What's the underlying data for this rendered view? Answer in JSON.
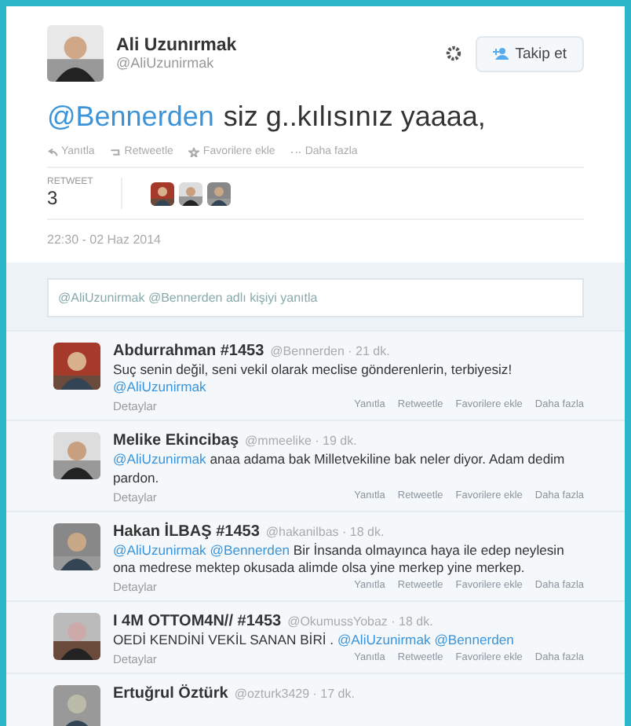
{
  "tweet": {
    "author": "Ali Uzunırmak",
    "handle": "@AliUzunirmak",
    "follow_button": "Takip et",
    "text": [
      {
        "kind": "mention",
        "text": "@Bennerden"
      },
      {
        "kind": "text",
        "text": "siz g..kılısınız yaaaa,"
      }
    ],
    "actions": [
      "Yanıtla",
      "Retweetle",
      "Favorilere ekle",
      "Daha fazla"
    ],
    "retweet_label": "RETWEET",
    "retweet_count": "3",
    "retweeters": [
      {
        "kind": "picture"
      },
      {
        "kind": "picture"
      },
      {
        "kind": "picture"
      }
    ],
    "date": "22:30 - 02 Haz 2014"
  },
  "reply_field": {
    "placeholder": "@AliUzunirmak @Bennerden adlı kişiyi yanıtla"
  },
  "replies": [
    {
      "name": "Abdurrahman #1453",
      "meta": "@Bennerden · 21 dk.",
      "text": [
        {
          "kind": "text",
          "text": "Suç senin değil, seni vekil olarak meclise gönderenlerin, terbiyesiz!"
        },
        {
          "kind": "mention",
          "text": "@AliUzunirmak"
        }
      ],
      "details": "Detaylar",
      "actions": [
        "Yanıtla",
        "Retweetle",
        "Favorilere ekle",
        "Daha fazla"
      ]
    },
    {
      "name": "Melike Ekincibaş",
      "meta": "@mmeelike · 19 dk.",
      "text": [
        {
          "kind": "mention",
          "text": "@AliUzunirmak"
        },
        {
          "kind": "text",
          "text": "anaa adama bak Milletvekiline bak neler diyor. Adam dedim pardon."
        }
      ],
      "details": "Detaylar",
      "actions": [
        "Yanıtla",
        "Retweetle",
        "Favorilere ekle",
        "Daha fazla"
      ]
    },
    {
      "name": "Hakan İLBAŞ #1453",
      "meta": "@hakanilbas · 18 dk.",
      "text": [
        {
          "kind": "mention",
          "text": "@AliUzunirmak"
        },
        {
          "kind": "mention",
          "text": "@Bennerden"
        },
        {
          "kind": "text",
          "text": "Bir İnsanda olmayınca haya ile edep neylesin ona medrese mektep okusada alimde olsa yine merkep yine merkep."
        }
      ],
      "details": "Detaylar",
      "actions": [
        "Yanıtla",
        "Retweetle",
        "Favorilere ekle",
        "Daha fazla"
      ]
    },
    {
      "name": "I 4M OTTOM4N// #1453",
      "meta": "@OkumussYobaz · 18 dk.",
      "text": [
        {
          "kind": "text",
          "text": "OEDİ KENDİNİ VEKİL SANAN BİRİ ."
        },
        {
          "kind": "mention",
          "text": "@AliUzunirmak"
        },
        {
          "kind": "mention",
          "text": "@Bennerden"
        }
      ],
      "details": "Detaylar",
      "actions": [
        "Yanıtla",
        "Retweetle",
        "Favorilere ekle",
        "Daha fazla"
      ]
    },
    {
      "name": "Ertuğrul Öztürk",
      "meta": "@ozturk3429 · 17 dk."
    }
  ]
}
